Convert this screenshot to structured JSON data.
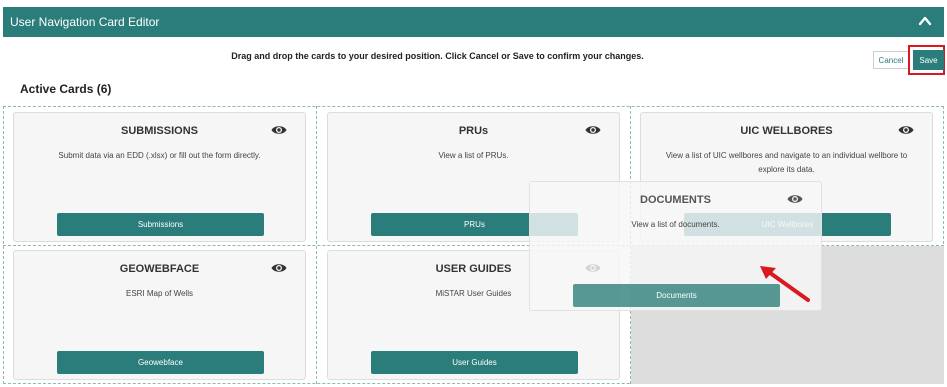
{
  "header": {
    "title": "User Navigation Card Editor"
  },
  "instructions": "Drag and drop the cards to your desired position. Click Cancel or Save to confirm your changes.",
  "actions": {
    "cancel_label": "Cancel",
    "save_label": "Save"
  },
  "section": {
    "title": "Active Cards (6)"
  },
  "cards": [
    {
      "title": "SUBMISSIONS",
      "description": "Submit data via an EDD (.xlsx) or fill out the form directly.",
      "button": "Submissions"
    },
    {
      "title": "PRUs",
      "description": "View a list of PRUs.",
      "button": "PRUs"
    },
    {
      "title": "UIC WELLBORES",
      "description": "View a list of UIC wellbores and navigate to an individual wellbore to explore its data.",
      "button": "UIC Wellbores"
    },
    {
      "title": "GEOWEBFACE",
      "description": "ESRI Map of Wells",
      "button": "Geowebface"
    },
    {
      "title": "USER GUIDES",
      "description": "MiSTAR User Guides",
      "button": "User Guides"
    }
  ],
  "dragging_card": {
    "title": "DOCUMENTS",
    "description": "View a list of documents.",
    "button": "Documents"
  },
  "colors": {
    "header_bg": "#2a7d7a",
    "button_bg": "#2a7d7a",
    "highlight": "#d8191f",
    "empty_slot": "#dddddd"
  },
  "icons": {
    "collapse": "chevron-up-icon",
    "visibility": "eye-icon",
    "annotation": "red-arrow"
  }
}
